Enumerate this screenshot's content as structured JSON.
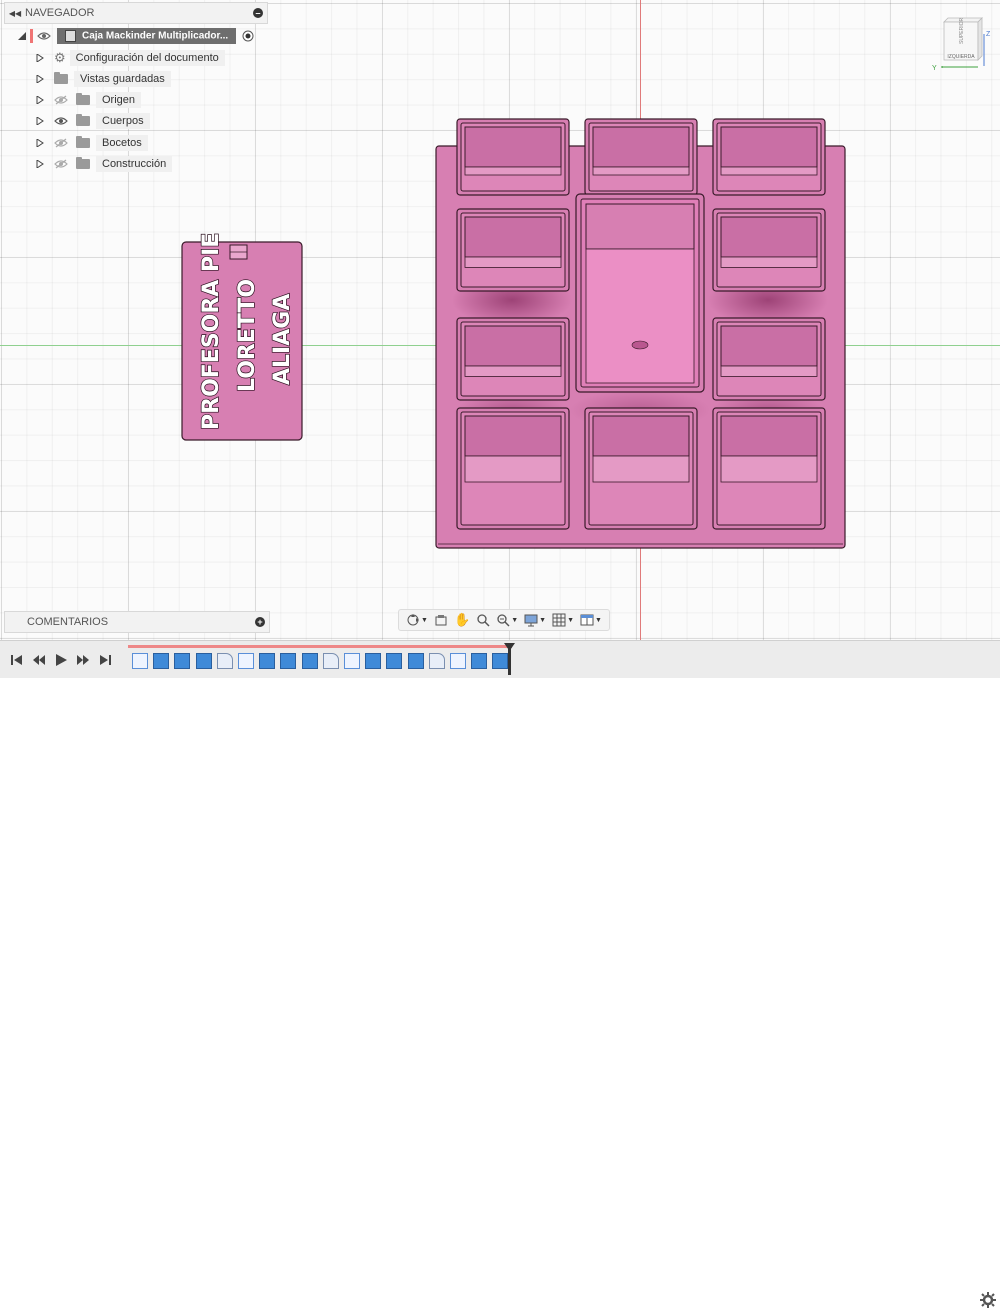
{
  "navigator": {
    "title": "NAVEGADOR",
    "root_label": "Caja Mackinder Multiplicador...",
    "items": [
      {
        "label": "Configuración del documento",
        "icon": "gear-icon"
      },
      {
        "label": "Vistas guardadas",
        "icon": "folder-icon"
      },
      {
        "label": "Origen",
        "icon": "folder-icon",
        "visible": false
      },
      {
        "label": "Cuerpos",
        "icon": "folder-icon",
        "visible": true
      },
      {
        "label": "Bocetos",
        "icon": "folder-icon",
        "visible": false
      },
      {
        "label": "Construcción",
        "icon": "folder-icon",
        "visible": false
      }
    ]
  },
  "comments": {
    "title": "COMENTARIOS"
  },
  "model": {
    "label_card_lines": [
      "PROFESORA PIE",
      "LORETTO",
      "ALIAGA"
    ],
    "colors": {
      "body": "#d77fb2",
      "body_dark": "#c5679f",
      "body_light": "#e9a6cd",
      "edge": "#3a1a2a",
      "shadow": "#9c3c72"
    }
  },
  "viewcube": {
    "face_front": "IZQUIERDA",
    "face_top": "SUPERIOR",
    "axis_z": "Z",
    "axis_y": "Y"
  },
  "colors": {
    "accent_x_axis": "#e07a7a",
    "accent_y_axis": "#8fd08f"
  },
  "timeline": {
    "feature_count": 18
  }
}
